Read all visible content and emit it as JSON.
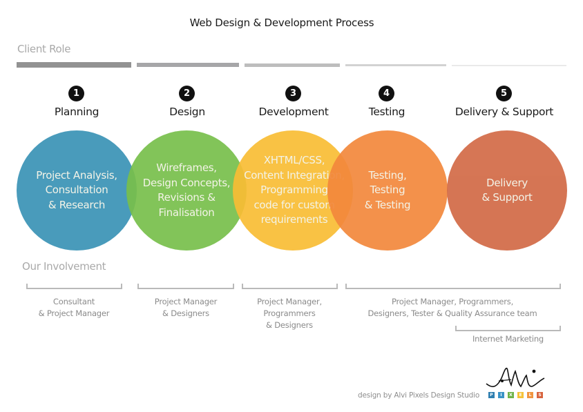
{
  "title": "Web Design & Development Process",
  "client_role": {
    "label": "Client Role",
    "bars": [
      {
        "stage": "Planning",
        "color": "#929292"
      },
      {
        "stage": "Design",
        "color": "#a6a6a8"
      },
      {
        "stage": "Development",
        "color": "#bdbdbd"
      },
      {
        "stage": "Testing",
        "color": "#d2d2d2"
      },
      {
        "stage": "Delivery & Support",
        "color": "#e9e9e9"
      }
    ]
  },
  "steps": [
    {
      "number": "1",
      "label": "Planning",
      "description": "Project Analysis,\nConsultation\n& Research",
      "color": "#3a93b6"
    },
    {
      "number": "2",
      "label": "Design",
      "description": "Wireframes,\nDesign Concepts,\nRevisions &\nFinalisation",
      "color": "#78bf4b"
    },
    {
      "number": "3",
      "label": "Development",
      "description": "XHTML/CSS,\nContent Integration,\nProgramming\ncode for custom\nrequirements",
      "color": "#f9bd35"
    },
    {
      "number": "4",
      "label": "Testing",
      "description": "Testing,\nTesting\n& Testing",
      "color": "#f2883c"
    },
    {
      "number": "5",
      "label": "Delivery & Support",
      "description": "Delivery\n& Support",
      "color": "#d26a46"
    }
  ],
  "involvement": {
    "label": "Our Involvement",
    "groups": [
      {
        "text": "Consultant\n& Project Manager"
      },
      {
        "text": "Project Manager\n& Designers"
      },
      {
        "text": "Project Manager,\nProgrammers\n& Designers"
      },
      {
        "text": "Project Manager, Programmers,\nDesigners, Tester & Quality Assurance team"
      },
      {
        "text": "Internet Marketing"
      }
    ]
  },
  "credit": "design by Alvi Pixels Design Studio",
  "logo": {
    "script": "Alvi",
    "letters": [
      {
        "char": "P",
        "color": "#2f7fb0"
      },
      {
        "char": "I",
        "color": "#3a93c6"
      },
      {
        "char": "X",
        "color": "#6fb34a"
      },
      {
        "char": "E",
        "color": "#f5c238"
      },
      {
        "char": "L",
        "color": "#f0943f"
      },
      {
        "char": "S",
        "color": "#d8643e"
      }
    ]
  }
}
